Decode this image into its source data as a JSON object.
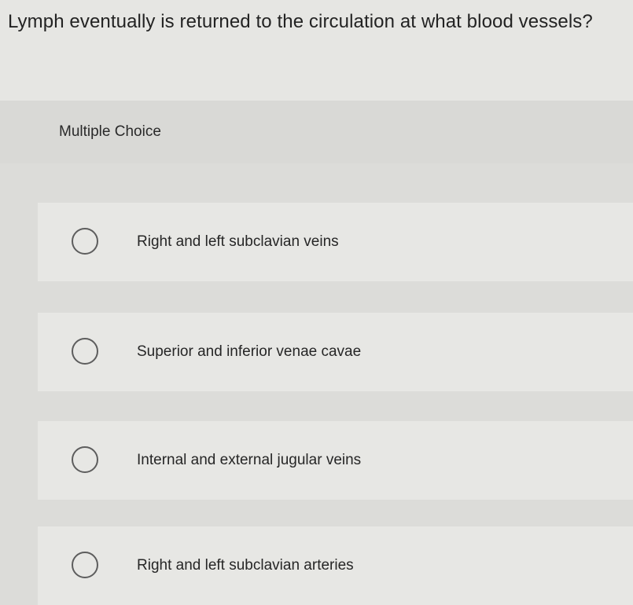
{
  "question": {
    "text": "Lymph eventually is returned to the circulation at what blood vessels?"
  },
  "question_type": {
    "label": "Multiple Choice"
  },
  "choices": [
    {
      "label": "Right and left subclavian veins",
      "selected": false
    },
    {
      "label": "Superior and inferior venae cavae",
      "selected": false
    },
    {
      "label": "Internal and external jugular veins",
      "selected": false
    },
    {
      "label": "Right and left subclavian arteries",
      "selected": false
    }
  ]
}
